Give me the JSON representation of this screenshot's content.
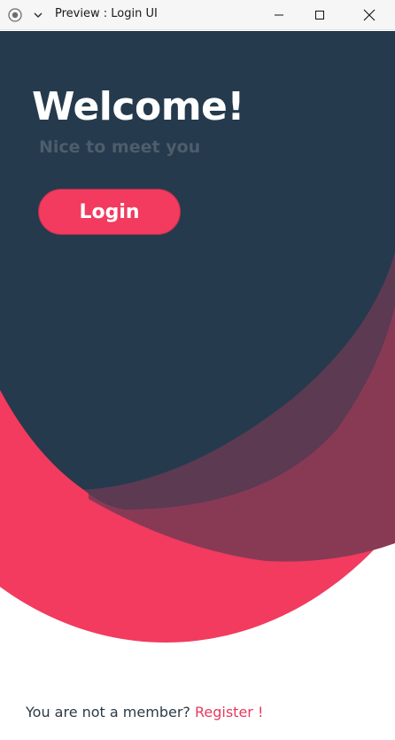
{
  "window": {
    "title": "Preview : Login UI",
    "icons": {
      "app": "record-icon",
      "menu": "chevron-down-icon",
      "minimize": "minimize-icon",
      "maximize": "maximize-icon",
      "close": "close-icon"
    }
  },
  "hero": {
    "heading": "Welcome!",
    "subheading": "Nice to meet you",
    "login_label": "Login"
  },
  "footer": {
    "prompt": "You are not a member?",
    "register_label": "Register !"
  },
  "colors": {
    "navy": "#253a4d",
    "accent": "#f23b5f",
    "mauve": "#883a55",
    "subtitle": "#4d5d6b",
    "background": "#ffffff"
  }
}
